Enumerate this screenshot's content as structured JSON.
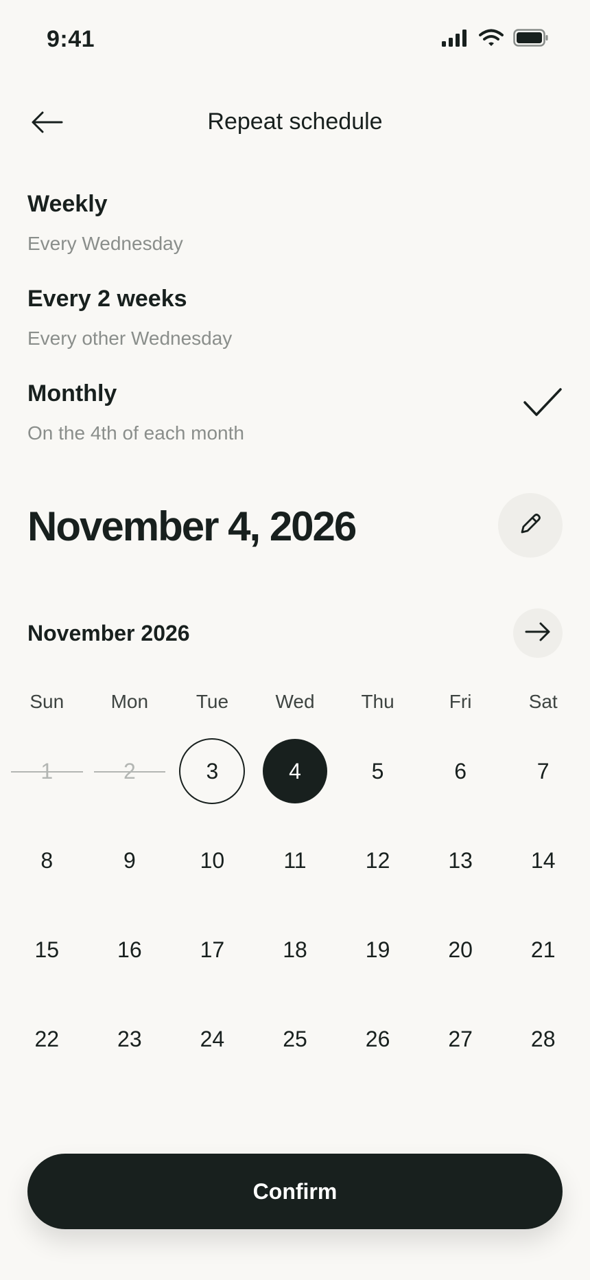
{
  "status_bar": {
    "time": "9:41",
    "icons": [
      "signal-icon",
      "wifi-icon",
      "battery-icon"
    ]
  },
  "header": {
    "title": "Repeat schedule",
    "back_icon": "arrow-left-icon"
  },
  "options": [
    {
      "title": "Weekly",
      "subtitle": "Every Wednesday",
      "selected": false
    },
    {
      "title": "Every 2 weeks",
      "subtitle": "Every other Wednesday",
      "selected": false
    },
    {
      "title": "Monthly",
      "subtitle": "On the 4th of each month",
      "selected": true
    }
  ],
  "selected_date": {
    "label": "November 4, 2026",
    "edit_icon": "pencil-icon"
  },
  "calendar": {
    "month_label": "November 2026",
    "next_icon": "arrow-right-icon",
    "weekdays": [
      "Sun",
      "Mon",
      "Tue",
      "Wed",
      "Thu",
      "Fri",
      "Sat"
    ],
    "days": [
      {
        "label": "1",
        "state": "disabled"
      },
      {
        "label": "2",
        "state": "disabled"
      },
      {
        "label": "3",
        "state": "today"
      },
      {
        "label": "4",
        "state": "selected"
      },
      {
        "label": "5",
        "state": "normal"
      },
      {
        "label": "6",
        "state": "normal"
      },
      {
        "label": "7",
        "state": "normal"
      },
      {
        "label": "8",
        "state": "normal"
      },
      {
        "label": "9",
        "state": "normal"
      },
      {
        "label": "10",
        "state": "normal"
      },
      {
        "label": "11",
        "state": "normal"
      },
      {
        "label": "12",
        "state": "normal"
      },
      {
        "label": "13",
        "state": "normal"
      },
      {
        "label": "14",
        "state": "normal"
      },
      {
        "label": "15",
        "state": "normal"
      },
      {
        "label": "16",
        "state": "normal"
      },
      {
        "label": "17",
        "state": "normal"
      },
      {
        "label": "18",
        "state": "normal"
      },
      {
        "label": "19",
        "state": "normal"
      },
      {
        "label": "20",
        "state": "normal"
      },
      {
        "label": "21",
        "state": "normal"
      },
      {
        "label": "22",
        "state": "normal"
      },
      {
        "label": "23",
        "state": "normal"
      },
      {
        "label": "24",
        "state": "normal"
      },
      {
        "label": "25",
        "state": "normal"
      },
      {
        "label": "26",
        "state": "normal"
      },
      {
        "label": "27",
        "state": "normal"
      },
      {
        "label": "28",
        "state": "normal"
      }
    ]
  },
  "confirm_label": "Confirm",
  "colors": {
    "background": "#f9f8f5",
    "primary": "#18201e",
    "muted": "#8a8e8b",
    "chip": "#efeeea"
  }
}
